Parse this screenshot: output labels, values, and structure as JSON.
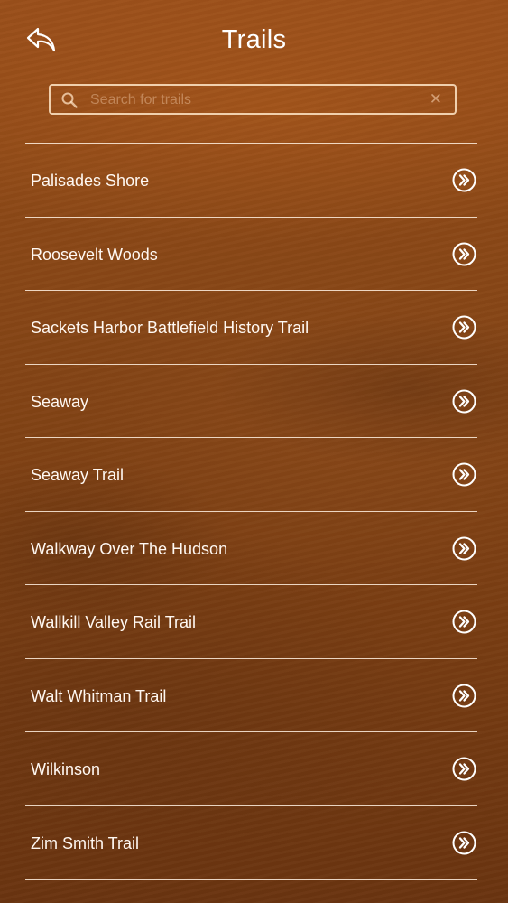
{
  "header": {
    "title": "Trails",
    "back_icon": "back-arrow-icon"
  },
  "search": {
    "placeholder": "Search for trails",
    "value": "",
    "search_icon": "search-icon",
    "clear_label": "✕"
  },
  "colors": {
    "background_top": "#9a4f1a",
    "background_bottom": "#6a3410",
    "text": "#ffffff",
    "divider": "#fff0e1"
  },
  "trails": [
    {
      "label": "Palisades Shore"
    },
    {
      "label": "Roosevelt Woods"
    },
    {
      "label": "Sackets Harbor Battlefield History Trail"
    },
    {
      "label": "Seaway"
    },
    {
      "label": "Seaway Trail"
    },
    {
      "label": "Walkway Over The Hudson"
    },
    {
      "label": "Wallkill Valley Rail Trail"
    },
    {
      "label": "Walt Whitman Trail"
    },
    {
      "label": "Wilkinson"
    },
    {
      "label": "Zim Smith Trail"
    }
  ]
}
